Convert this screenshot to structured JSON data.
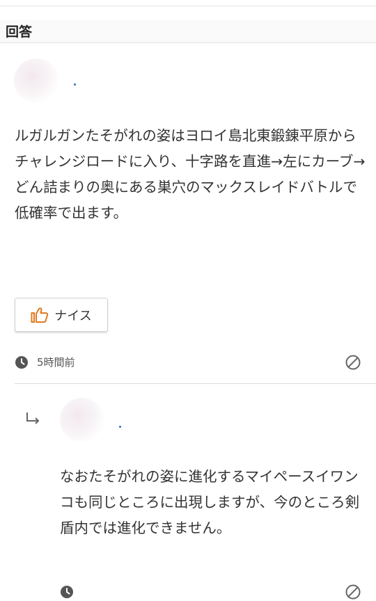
{
  "section": {
    "title": "回答"
  },
  "answer": {
    "text": "ルガルガンたそがれの姿はヨロイ島北東鍛錬平原からチャレンジロードに入り、十字路を直進→左にカーブ→どん詰まりの奥にある巣穴のマックスレイドバトルで低確率で出ます。",
    "nice_label": "ナイス",
    "timestamp": "5時間前",
    "icons": {
      "like": "thumbs-up-icon",
      "clock": "clock-icon",
      "block": "block-icon",
      "reply": "reply-arrow-icon"
    }
  },
  "reply": {
    "text": "なおたそがれの姿に進化するマイペースイワンコも同じところに出現しますが、今のところ剣盾内では進化できません。"
  },
  "colors": {
    "accent_dot": "#2d6fb7",
    "divider": "#dcdcdc",
    "text": "#333333"
  }
}
